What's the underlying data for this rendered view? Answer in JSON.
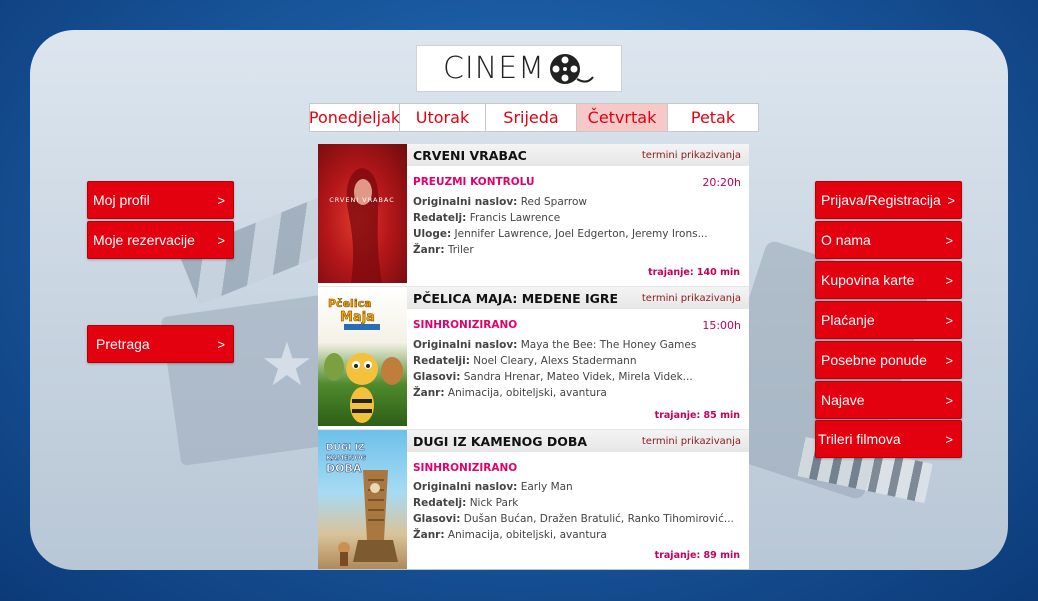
{
  "logo": {
    "text": "CINEM"
  },
  "days": [
    {
      "label": "Ponedjeljak",
      "active": false
    },
    {
      "label": "Utorak",
      "active": false
    },
    {
      "label": "Srijeda",
      "active": false
    },
    {
      "label": "Četvrtak",
      "active": true
    },
    {
      "label": "Petak",
      "active": false
    }
  ],
  "left_menu": [
    {
      "label": "Moj profil",
      "arrow": ">"
    },
    {
      "label": "Moje rezervacije",
      "arrow": ">"
    },
    {
      "label": "Pretraga",
      "arrow": ">"
    }
  ],
  "right_menu": [
    {
      "label": "Prijava/Registracija",
      "arrow": ">"
    },
    {
      "label": "O nama",
      "arrow": ">"
    },
    {
      "label": "Kupovina karte",
      "arrow": ">"
    },
    {
      "label": "Plaćanje",
      "arrow": ">"
    },
    {
      "label": "Posebne ponude",
      "arrow": ">"
    },
    {
      "label": "Najave",
      "arrow": ">"
    },
    {
      "label": "Trileri filmova",
      "arrow": ">"
    }
  ],
  "movies": [
    {
      "title": "CRVENI VRABAC",
      "termini": "termini prikazivanja",
      "tag": "PREUZMI KONTROLU",
      "time": "20:20h",
      "rows": [
        {
          "label": "Originalni naslov:",
          "value": " Red Sparrow"
        },
        {
          "label": "Redatelj:",
          "value": " Francis Lawrence"
        },
        {
          "label": "Uloge:",
          "value": " Jennifer Lawrence, Joel Edgerton, Jeremy Irons..."
        },
        {
          "label": "Žanr:",
          "value": " Triler"
        }
      ],
      "duration": "trajanje: 140 min"
    },
    {
      "title": "PČELICA MAJA: MEDENE IGRE",
      "termini": "termini prikazivanja",
      "tag": "SINHRONIZIRANO",
      "time": "15:00h",
      "rows": [
        {
          "label": "Originalni naslov:",
          "value": " Maya the Bee: The Honey Games"
        },
        {
          "label": "Redatelji:",
          "value": " Noel Cleary, Alexs Stadermann"
        },
        {
          "label": "Glasovi:",
          "value": " Sandra Hrenar, Mateo Videk, Mirela Videk..."
        },
        {
          "label": "Žanr:",
          "value": " Animacija, obiteljski, avantura"
        }
      ],
      "duration": "trajanje: 85 min"
    },
    {
      "title": "DUGI IZ KAMENOG DOBA",
      "termini": "termini prikazivanja",
      "tag": "SINHRONIZIRANO",
      "time": "",
      "rows": [
        {
          "label": "Originalni naslov:",
          "value": " Early Man"
        },
        {
          "label": "Redatelj:",
          "value": " Nick Park"
        },
        {
          "label": "Glasovi:",
          "value": " Dušan Bućan, Dražen Bratulić, Ranko Tihomirović..."
        },
        {
          "label": "Žanr:",
          "value": " Animacija, obiteljski, avantura"
        }
      ],
      "duration": "trajanje: 89 min"
    }
  ],
  "posters": [
    {
      "lines": [
        "CRVENI VRABAC"
      ]
    },
    {
      "lines": [
        "Pčelica",
        "Maja"
      ]
    },
    {
      "lines": [
        "DUGI IZ",
        "KAMENOG",
        "DOBA"
      ]
    }
  ]
}
